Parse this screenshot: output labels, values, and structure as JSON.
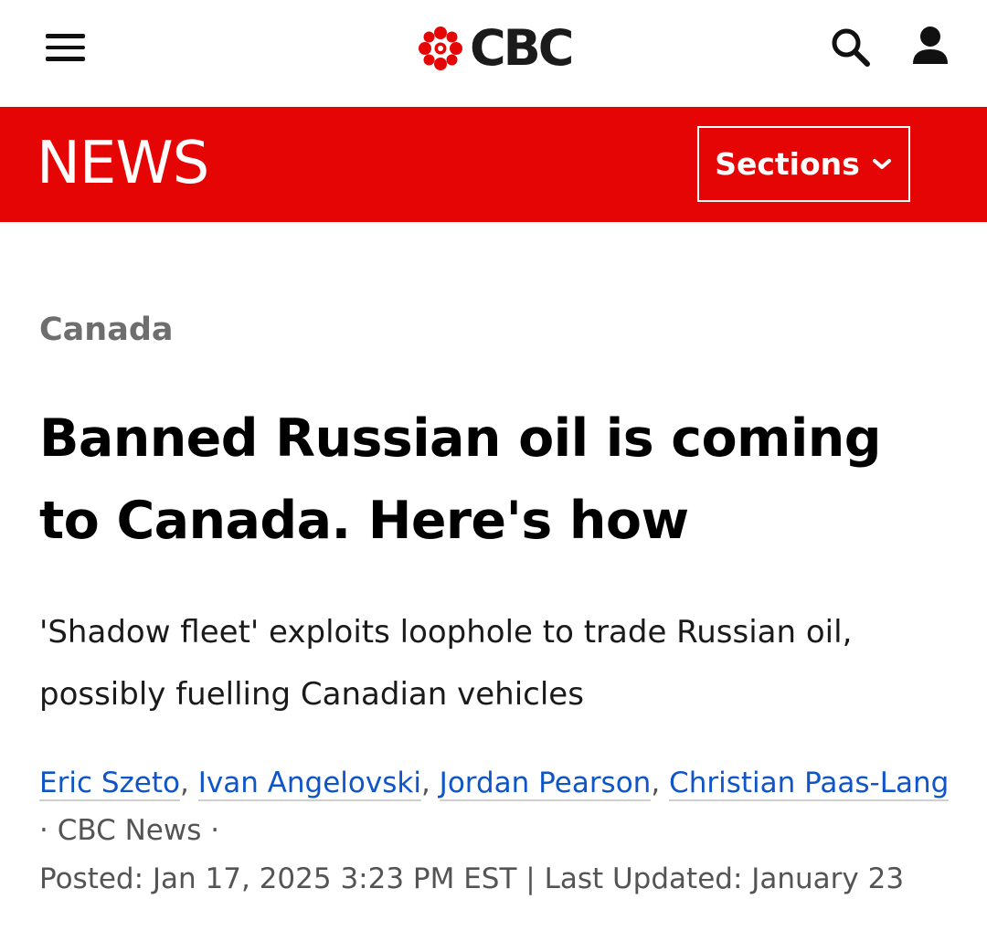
{
  "header": {
    "menu_icon": "hamburger-menu-icon",
    "brand_icon": "cbc-gem-logo",
    "brand_name": "CBC",
    "search_icon": "search-icon",
    "account_icon": "user-account-icon"
  },
  "news_bar": {
    "title": "NEWS",
    "sections_label": "Sections",
    "sections_icon": "chevron-down-icon",
    "background_color": "#e60505"
  },
  "article": {
    "category": "Canada",
    "headline": "Banned Russian oil is coming to Canada. Here's how",
    "dek": "'Shadow fleet' exploits loophole to trade Russian oil, possibly fuelling Canadian vehicles",
    "authors": [
      "Eric Szeto",
      "Ivan Angelovski",
      "Jordan Pearson",
      "Christian Paas-Lang"
    ],
    "author_separator": ", ",
    "source": "CBC News",
    "dot_separator": "·",
    "posted": "Posted: Jan 17, 2025 3:23 PM EST | Last Updated: January 23",
    "link_color": "#0f55c8"
  }
}
